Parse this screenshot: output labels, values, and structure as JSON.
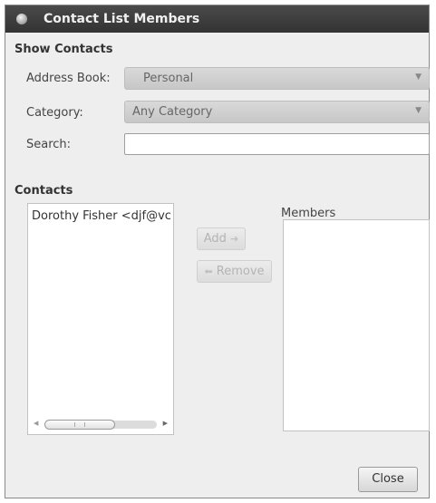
{
  "window": {
    "title": "Contact List Members"
  },
  "show_contacts": {
    "heading": "Show Contacts",
    "address_book_label": "Address Book:",
    "address_book_value": "Personal",
    "category_label": "Category:",
    "category_value": "Any Category",
    "search_label": "Search:",
    "search_value": ""
  },
  "contacts": {
    "heading": "Contacts",
    "items": [
      "Dorothy Fisher <djf@vc"
    ]
  },
  "members": {
    "heading": "Members",
    "items": []
  },
  "buttons": {
    "add": "Add",
    "remove": "Remove",
    "close": "Close"
  },
  "icons": {
    "title": "app-icon",
    "combo_arrow": "chevron-down-icon",
    "add": "arrow-right-icon",
    "remove": "arrow-left-icon",
    "scroll_left": "arrow-left-icon",
    "scroll_right": "arrow-right-icon"
  }
}
